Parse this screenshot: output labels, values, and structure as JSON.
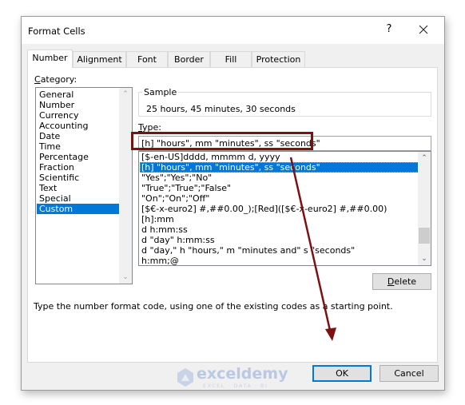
{
  "window": {
    "title": "Format Cells",
    "help_label": "?",
    "close_icon": "close-icon"
  },
  "tabs": [
    {
      "label": "Number",
      "active": true
    },
    {
      "label": "Alignment",
      "active": false
    },
    {
      "label": "Font",
      "active": false
    },
    {
      "label": "Border",
      "active": false
    },
    {
      "label": "Fill",
      "active": false
    },
    {
      "label": "Protection",
      "active": false
    }
  ],
  "category": {
    "label_prefix": "C",
    "label_rest": "ategory:",
    "items": [
      "General",
      "Number",
      "Currency",
      "Accounting",
      "Date",
      "Time",
      "Percentage",
      "Fraction",
      "Scientific",
      "Text",
      "Special",
      "Custom"
    ],
    "selected": "Custom"
  },
  "sample": {
    "legend": "Sample",
    "value": "25 hours, 45 minutes, 30 seconds"
  },
  "type": {
    "label_prefix": "T",
    "label_rest": "ype:",
    "input_value": "[h] \"hours\", mm \"minutes\", ss \"seconds\"",
    "items": [
      "[$-en-US]dddd, mmmm d, yyyy",
      "[h] \"hours\", mm \"minutes\", ss \"seconds\"",
      "\"Yes\";\"Yes\";\"No\"",
      "\"True\";\"True\";\"False\"",
      "\"On\";\"On\";\"Off\"",
      "[$€-x-euro2] #,##0.00_);[Red]([$€-x-euro2] #,##0.00)",
      "[h]:mm",
      "d h:mm:ss",
      "d \"day\" h:mm:ss",
      "d \"day,\" h \"hours,\" m \"minutes and\" s \"seconds\"",
      "h:mm;@"
    ],
    "selected_index": 1
  },
  "delete_button": {
    "prefix": "D",
    "rest": "elete"
  },
  "hint": "Type the number format code, using one of the existing codes as a starting point.",
  "ok_label": "OK",
  "cancel_label": "Cancel",
  "watermark": {
    "brand": "exceldemy",
    "tagline": "EXCEL · DATA · BI"
  },
  "annotation": {
    "color": "#7b1113"
  },
  "colors": {
    "selection": "#0078d7",
    "default_button_border": "#0078d7"
  }
}
